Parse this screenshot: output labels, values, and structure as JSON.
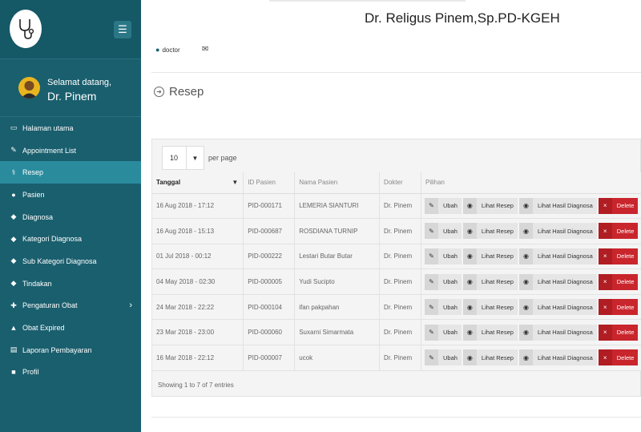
{
  "header": {
    "doctor_title": "Dr. Religus Pinem,Sp.PD-KGEH",
    "user_label": "doctor"
  },
  "sidebar": {
    "welcome": "Selamat datang,",
    "user_name": "Dr. Pinem",
    "items": [
      {
        "label": "Halaman utama",
        "icon": "monitor-icon"
      },
      {
        "label": "Appointment List",
        "icon": "edit-icon"
      },
      {
        "label": "Resep",
        "icon": "stethoscope-icon"
      },
      {
        "label": "Pasien",
        "icon": "user-icon"
      },
      {
        "label": "Diagnosa",
        "icon": "tag-icon"
      },
      {
        "label": "Kategori Diagnosa",
        "icon": "tag-icon"
      },
      {
        "label": "Sub Kategori Diagnosa",
        "icon": "tag-icon"
      },
      {
        "label": "Tindakan",
        "icon": "tag-icon"
      },
      {
        "label": "Pengaturan Obat",
        "icon": "medkit-icon"
      },
      {
        "label": "Obat Expired",
        "icon": "warning-icon"
      },
      {
        "label": "Laporan Pembayaran",
        "icon": "book-icon"
      },
      {
        "label": "Profil",
        "icon": "lock-icon"
      }
    ]
  },
  "page": {
    "title": "Resep",
    "per_page_value": "10",
    "per_page_label": "per page",
    "footer": "Showing 1 to 7 of 7 entries"
  },
  "table": {
    "headers": [
      "Tanggal",
      "ID Pasien",
      "Nama Pasien",
      "Dokter",
      "Pilihan"
    ],
    "actions": {
      "edit": "Ubah",
      "view_recipe": "Lihat Resep",
      "view_diagnosis": "Lihat Hasil Diagnosa",
      "delete": "Delete"
    },
    "rows": [
      {
        "date": "16 Aug 2018 - 17:12",
        "id": "PID-000171",
        "name": "LEMERIA SIANTURI",
        "doctor": "Dr. Pinem"
      },
      {
        "date": "16 Aug 2018 - 15:13",
        "id": "PID-000687",
        "name": "ROSDIANA TURNIP",
        "doctor": "Dr. Pinem"
      },
      {
        "date": "01 Jul 2018 - 00:12",
        "id": "PID-000222",
        "name": "Lestari Butar Butar",
        "doctor": "Dr. Pinem"
      },
      {
        "date": "04 May 2018 - 02:30",
        "id": "PID-000005",
        "name": "Yudi Sucipto",
        "doctor": "Dr. Pinem"
      },
      {
        "date": "24 Mar 2018 - 22:22",
        "id": "PID-000104",
        "name": "ifan pakpahan",
        "doctor": "Dr. Pinem"
      },
      {
        "date": "23 Mar 2018 - 23:00",
        "id": "PID-000060",
        "name": "Suxarni Simarmata",
        "doctor": "Dr. Pinem"
      },
      {
        "date": "16 Mar 2018 - 22:12",
        "id": "PID-000007",
        "name": "ucok",
        "doctor": "Dr. Pinem"
      }
    ]
  },
  "colors": {
    "sidebar": "#1a5f6e",
    "active_item": "#2a8b9d",
    "delete": "#c9252c"
  }
}
